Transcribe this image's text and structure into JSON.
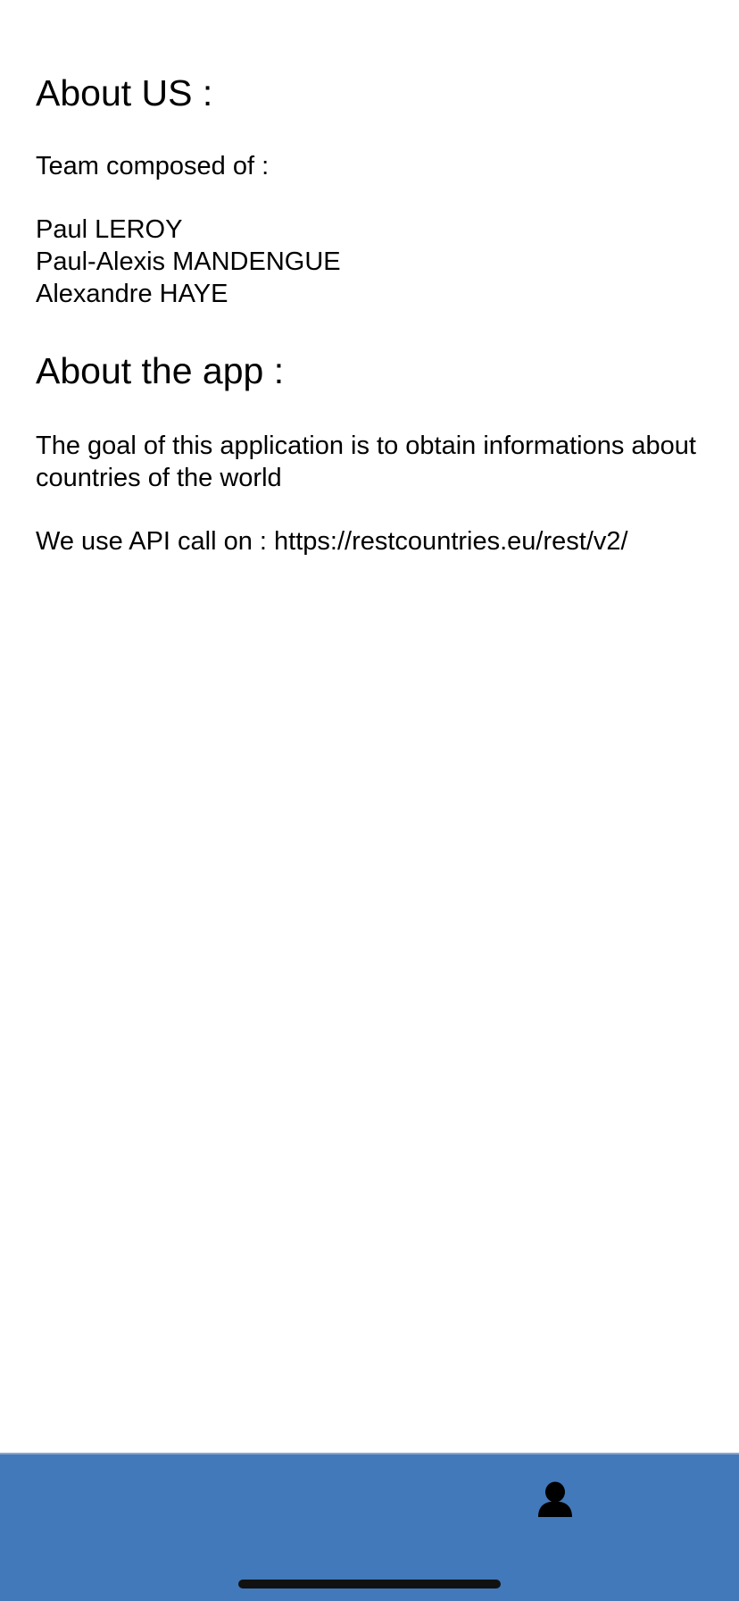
{
  "about_us": {
    "heading": "About US :",
    "team_intro": "Team composed of :",
    "members": [
      "Paul LEROY",
      "Paul-Alexis MANDENGUE",
      "Alexandre HAYE"
    ]
  },
  "about_app": {
    "heading": "About the app :",
    "goal": "The goal of this application is to obtain informations about countries of the world",
    "api": "We use API call on : https://restcountries.eu/rest/v2/"
  },
  "tab_bar": {
    "background_color": "#4279ba",
    "items": [
      {
        "icon": "person-icon",
        "active": true
      }
    ]
  }
}
